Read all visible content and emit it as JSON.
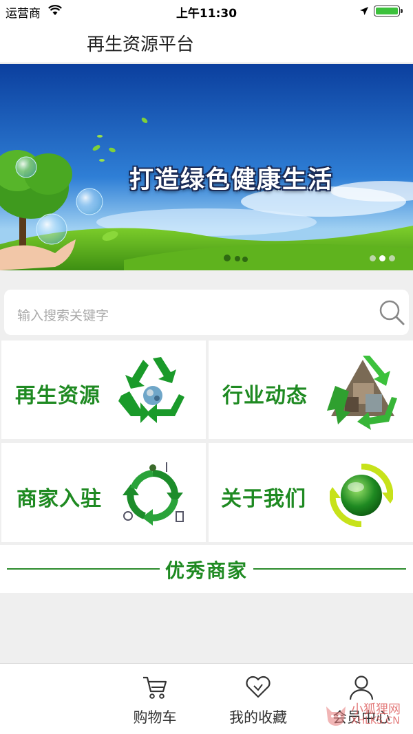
{
  "status_bar": {
    "carrier": "运营商",
    "time": "上午11:30",
    "battery_level": 1.0
  },
  "nav": {
    "title": "再生资源平台"
  },
  "banner": {
    "slogan": "打造绿色健康生活",
    "slide_count": 3,
    "active_slide": 2
  },
  "search": {
    "placeholder": "输入搜索关键字"
  },
  "tiles": [
    {
      "label": "再生资源",
      "icon": "recycle-icon"
    },
    {
      "label": "行业动态",
      "icon": "recycle-photo-icon"
    },
    {
      "label": "商家入驻",
      "icon": "eco-cycle-icon"
    },
    {
      "label": "关于我们",
      "icon": "green-circle-icon"
    }
  ],
  "section": {
    "title": "优秀商家"
  },
  "tab_bar": {
    "items": [
      {
        "label": "购物车",
        "icon": "cart-icon"
      },
      {
        "label": "我的收藏",
        "icon": "heart-icon"
      },
      {
        "label": "会员中心",
        "icon": "user-icon"
      }
    ]
  },
  "watermark": {
    "top": "小狐狸网",
    "bottom": "XHLKS.CN"
  },
  "colors": {
    "accent_green": "#1f8a22",
    "battery_green": "#3cc13c"
  }
}
